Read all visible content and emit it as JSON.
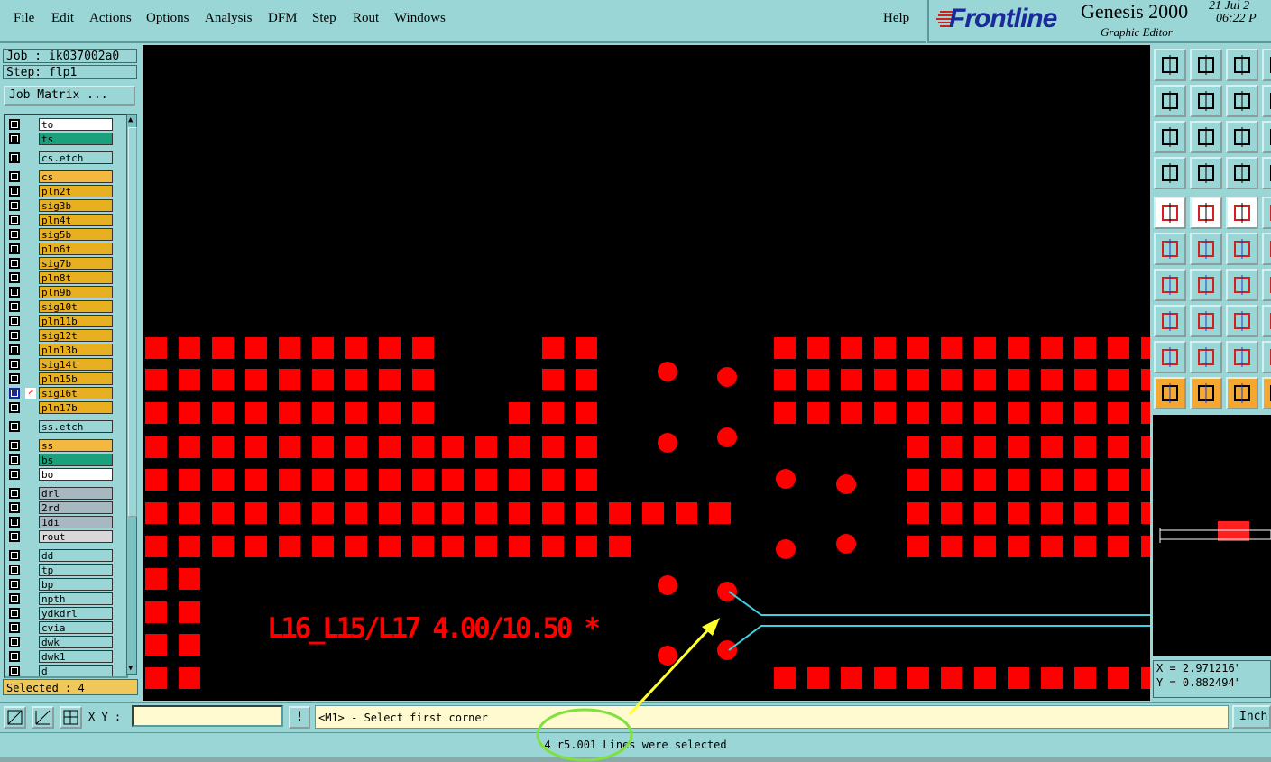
{
  "menubar": {
    "items": [
      {
        "label": "File"
      },
      {
        "label": "Edit"
      },
      {
        "label": "Actions"
      },
      {
        "label": "Options"
      },
      {
        "label": "Analysis"
      },
      {
        "label": "DFM"
      },
      {
        "label": "Step"
      },
      {
        "label": "Rout"
      },
      {
        "label": "Windows"
      }
    ],
    "help_label": "Help"
  },
  "brand": {
    "logo": "Frontline",
    "app_name": "Genesis 2000",
    "app_subtitle": "Graphic Editor",
    "date": "21 Jul 2",
    "time": "06:22 P"
  },
  "job": {
    "job_label": "Job : ik037002a0",
    "step_label": "Step: flp1",
    "job_matrix_button": "Job Matrix ..."
  },
  "layers": [
    {
      "name": "to",
      "color": "#ffffff"
    },
    {
      "name": "ts",
      "color": "#1aa07a"
    },
    {
      "name": "cs.etch",
      "color": "#9ad6d6"
    },
    {
      "name": "cs",
      "color": "#f4b840"
    },
    {
      "name": "pln2t",
      "color": "#e8b020"
    },
    {
      "name": "sig3b",
      "color": "#e8b020"
    },
    {
      "name": "pln4t",
      "color": "#e8b020"
    },
    {
      "name": "sig5b",
      "color": "#e8b020"
    },
    {
      "name": "pln6t",
      "color": "#e8b020"
    },
    {
      "name": "sig7b",
      "color": "#e8b020"
    },
    {
      "name": "pln8t",
      "color": "#e8b020"
    },
    {
      "name": "pln9b",
      "color": "#e8b020"
    },
    {
      "name": "sig10t",
      "color": "#e8b020"
    },
    {
      "name": "pln11b",
      "color": "#e8b020"
    },
    {
      "name": "sig12t",
      "color": "#e8b020"
    },
    {
      "name": "pln13b",
      "color": "#e8b020"
    },
    {
      "name": "sig14t",
      "color": "#e8b020"
    },
    {
      "name": "pln15b",
      "color": "#e8b020"
    },
    {
      "name": "sig16t",
      "color": "#e8b020",
      "active": true
    },
    {
      "name": "pln17b",
      "color": "#e8b020"
    },
    {
      "name": "ss.etch",
      "color": "#9ad6d6"
    },
    {
      "name": "ss",
      "color": "#f4b840"
    },
    {
      "name": "bs",
      "color": "#1aa07a"
    },
    {
      "name": "bo",
      "color": "#ffffff"
    },
    {
      "name": "drl",
      "color": "#a8b8c0"
    },
    {
      "name": "2rd",
      "color": "#a8b8c0"
    },
    {
      "name": "1di",
      "color": "#a8b8c0"
    },
    {
      "name": "rout",
      "color": "#d8d8d8"
    },
    {
      "name": "dd",
      "color": "#9ad6d6"
    },
    {
      "name": "tp",
      "color": "#9ad6d6"
    },
    {
      "name": "bp",
      "color": "#9ad6d6"
    },
    {
      "name": "npth",
      "color": "#9ad6d6"
    },
    {
      "name": "ydkdrl",
      "color": "#9ad6d6"
    },
    {
      "name": "cvia",
      "color": "#9ad6d6"
    },
    {
      "name": "dwk",
      "color": "#9ad6d6"
    },
    {
      "name": "dwk1",
      "color": "#9ad6d6"
    },
    {
      "name": "d",
      "color": "#9ad6d6"
    }
  ],
  "selection": {
    "selected_label": "Selected : 4"
  },
  "canvas": {
    "annotation_text": "L16_L15/L17 4.00/10.50 *",
    "pad_color": "#ff0000",
    "trace_color": "#40d0e0",
    "arrow_color": "#ffff30",
    "highlight_color": "#80e040"
  },
  "coordinates": {
    "x": "X = 2.971216\"",
    "y": "Y = 0.882494\""
  },
  "bottom": {
    "xy_label": "X Y :",
    "xy_value": "",
    "prompt": "<M1> - Select first corner",
    "units_button": "Inch",
    "status": "4 r5.001 Lines were selected"
  }
}
